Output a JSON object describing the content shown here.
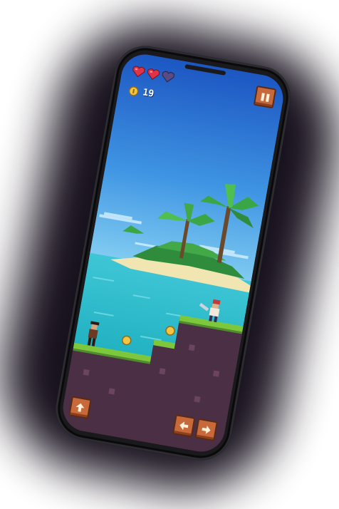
{
  "hud": {
    "lives_total": 3,
    "lives_remaining": 2,
    "coin_count": "19"
  },
  "icons": {
    "heart": "heart-icon",
    "coin": "coin-icon",
    "pause": "pause-icon",
    "jump": "arrow-up-icon",
    "left": "arrow-left-icon",
    "right": "arrow-right-icon"
  },
  "colors": {
    "sky_top": "#1f62c9",
    "sky_bottom": "#6fc0f2",
    "sea": "#2ec3c9",
    "heart_full": "#e03347",
    "heart_empty": "#5a4b86",
    "button": "#c7693a",
    "grass": "#7cc73b",
    "dirt": "#5a3a4f"
  }
}
